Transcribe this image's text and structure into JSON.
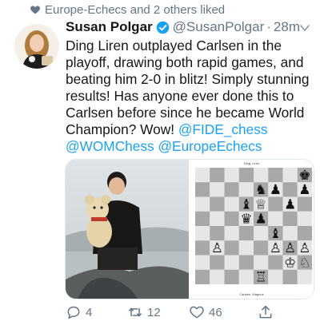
{
  "context": {
    "liked_by": "Europe-Echecs and 2 others liked"
  },
  "tweet": {
    "name": "Susan Polgar",
    "handle": "@SusanPolgar",
    "dot": "·",
    "time": "28m",
    "text_main": "Ding Liren outplayed Carlsen in the playoff, drawing both rapid games, and beating him 2-0 in blitz! Simply stunning results! Has anyone ever done this to Carlsen before since he became World Champion? Wow! ",
    "mentions": [
      "@FIDE_chess",
      "@WOMChess",
      "@EuropeEchecs"
    ]
  },
  "board": {
    "top_label": "Ding, Liren",
    "bottom_label": "Carlsen, Magnus",
    "pieces": [
      {
        "sq": "h8",
        "p": "k",
        "c": "b"
      },
      {
        "sq": "e7",
        "p": "n",
        "c": "b"
      },
      {
        "sq": "f7",
        "p": "p",
        "c": "b"
      },
      {
        "sq": "h7",
        "p": "p",
        "c": "b"
      },
      {
        "sq": "d6",
        "p": "b",
        "c": "b"
      },
      {
        "sq": "e6",
        "p": "q",
        "c": "w"
      },
      {
        "sq": "g6",
        "p": "p",
        "c": "b"
      },
      {
        "sq": "d5",
        "p": "q",
        "c": "b"
      },
      {
        "sq": "e5",
        "p": "p",
        "c": "b"
      },
      {
        "sq": "f4",
        "p": "b",
        "c": "b"
      },
      {
        "sq": "b3",
        "p": "p",
        "c": "w"
      },
      {
        "sq": "f3",
        "p": "p",
        "c": "w"
      },
      {
        "sq": "g3",
        "p": "p",
        "c": "w"
      },
      {
        "sq": "h3",
        "p": "p",
        "c": "w"
      },
      {
        "sq": "g2",
        "p": "k",
        "c": "w"
      },
      {
        "sq": "h2",
        "p": "n",
        "c": "w"
      },
      {
        "sq": "e1",
        "p": "r",
        "c": "w"
      }
    ]
  },
  "actions": {
    "replies": "4",
    "retweets": "12",
    "likes": "46"
  },
  "colors": {
    "link": "#1da1f2",
    "secondary": "#657786",
    "board_light": "#e6e6e6",
    "board_dark": "#a8a8a8"
  }
}
